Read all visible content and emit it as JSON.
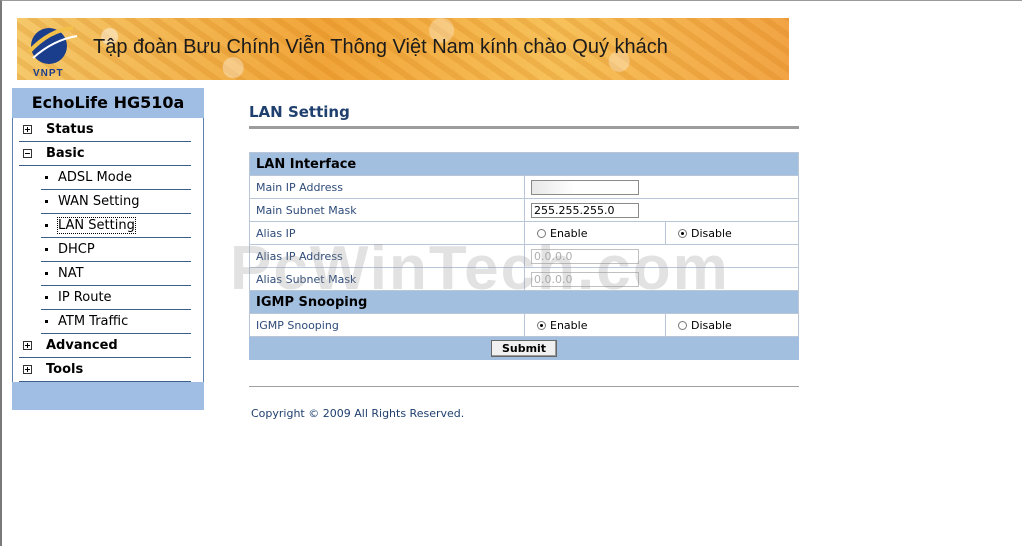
{
  "banner": {
    "logo_label": "VNPT",
    "greeting": "Tập đoàn Bưu Chính Viễn Thông Việt Nam kính chào Quý khách"
  },
  "sidebar": {
    "title": "EchoLife HG510a",
    "items": [
      {
        "label": "Status",
        "type": "group",
        "expanded": false
      },
      {
        "label": "Basic",
        "type": "group",
        "expanded": true
      },
      {
        "label": "ADSL Mode",
        "type": "sub"
      },
      {
        "label": "WAN Setting",
        "type": "sub"
      },
      {
        "label": "LAN Setting",
        "type": "sub",
        "active": true
      },
      {
        "label": "DHCP",
        "type": "sub"
      },
      {
        "label": "NAT",
        "type": "sub"
      },
      {
        "label": "IP Route",
        "type": "sub"
      },
      {
        "label": "ATM Traffic",
        "type": "sub"
      },
      {
        "label": "Advanced",
        "type": "group",
        "expanded": false
      },
      {
        "label": "Tools",
        "type": "group",
        "expanded": false
      }
    ]
  },
  "page": {
    "title": "LAN Setting"
  },
  "lan": {
    "section": "LAN Interface",
    "main_ip_label": "Main IP Address",
    "main_ip_value": "",
    "subnet_label": "Main Subnet Mask",
    "subnet_value": "255.255.255.0",
    "alias_ip_label": "Alias IP",
    "enable_label": "Enable",
    "disable_label": "Disable",
    "alias_ip_selected": "Disable",
    "alias_addr_label": "Alias IP Address",
    "alias_addr_value": "0.0.0.0",
    "alias_mask_label": "Alias Subnet Mask",
    "alias_mask_value": "0.0.0.0"
  },
  "igmp": {
    "section": "IGMP Snooping",
    "label": "IGMP Snooping",
    "enable_label": "Enable",
    "disable_label": "Disable",
    "selected": "Enable"
  },
  "actions": {
    "submit_label": "Submit"
  },
  "footer": {
    "copyright": "Copyright © 2009 All Rights Reserved."
  },
  "watermark": "PcWinTech.com",
  "colors": {
    "accent_blue": "#a0bde3",
    "title_blue": "#1f3f6e",
    "banner_orange": "#f1a53a"
  }
}
